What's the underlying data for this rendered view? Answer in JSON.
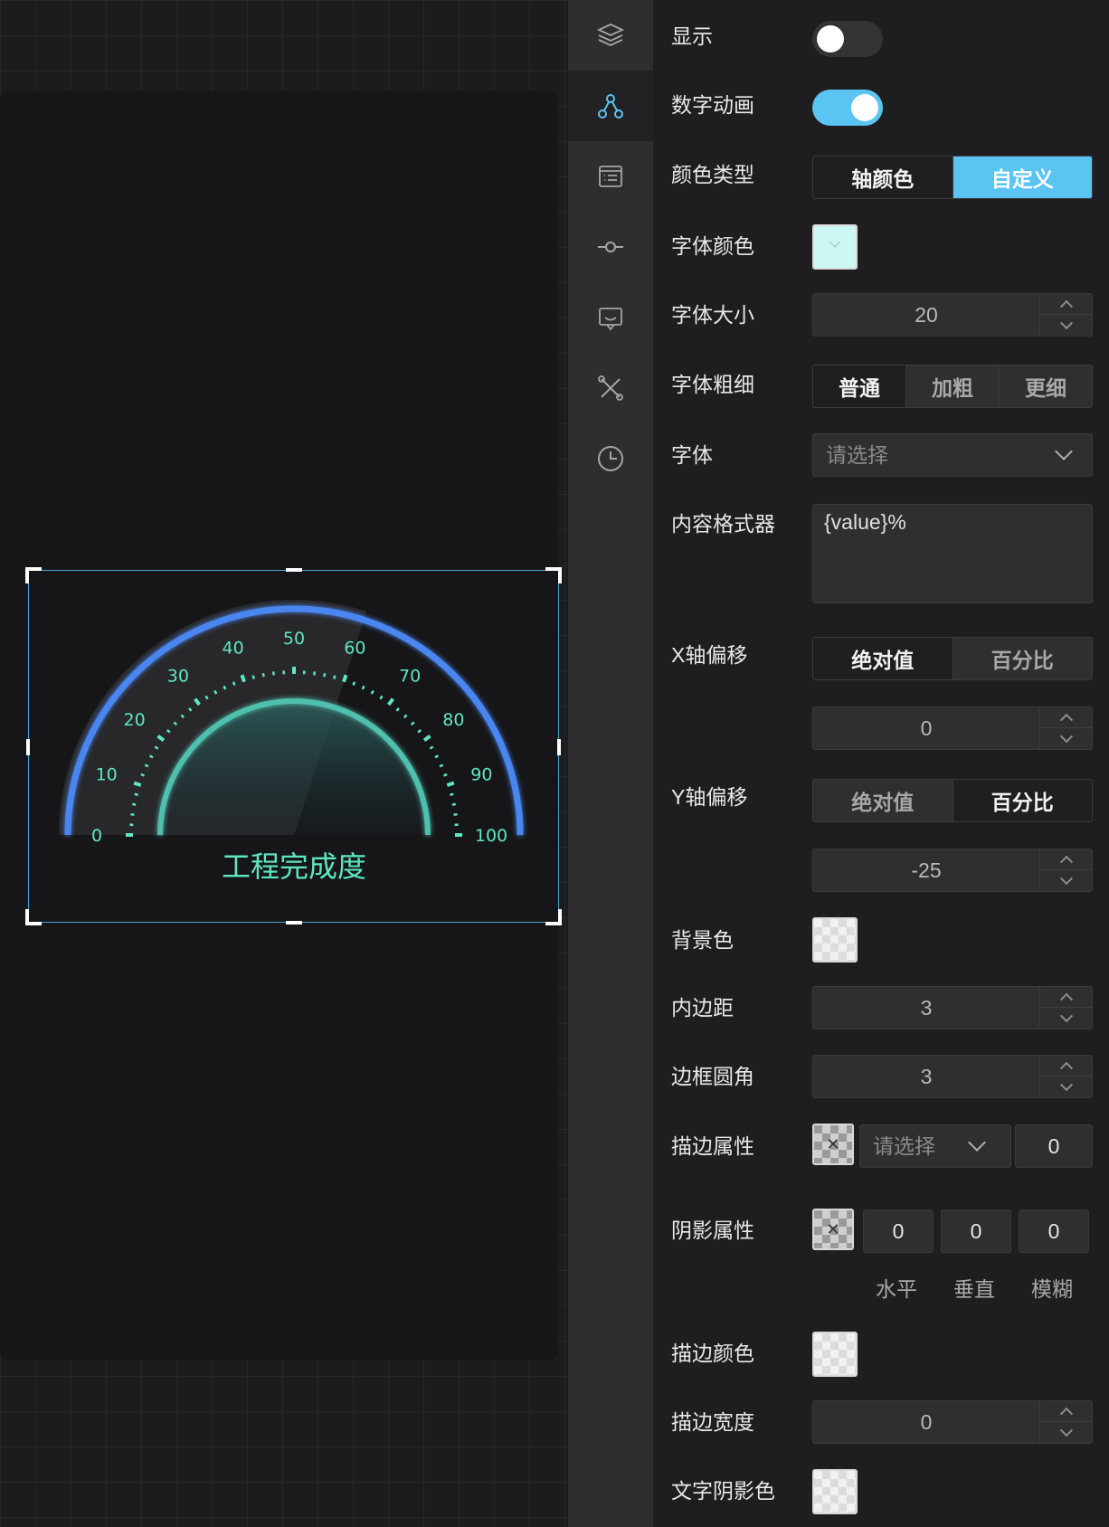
{
  "gauge": {
    "title": "工程完成度",
    "min": 0,
    "max": 100,
    "progress": 60,
    "ticks": [
      "0",
      "10",
      "20",
      "30",
      "40",
      "50",
      "60",
      "70",
      "80",
      "90",
      "100"
    ],
    "colors": {
      "arc": "#4a86f0",
      "accent": "#5ee6c3",
      "inner": "#4fbfae"
    }
  },
  "rail": {
    "icons": [
      "layers-icon",
      "component-nodes-icon",
      "data-list-icon",
      "event-commit-icon",
      "message-icon",
      "tools-icon",
      "clock-icon"
    ],
    "active_index": 1,
    "accent": "#5ac4f3"
  },
  "props": {
    "show": {
      "label": "显示",
      "on": false
    },
    "number_animation": {
      "label": "数字动画",
      "on": true
    },
    "color_type": {
      "label": "颜色类型",
      "options": [
        "轴颜色",
        "自定义"
      ],
      "selected": 1
    },
    "font_color": {
      "label": "字体颜色",
      "value": "#cdf7f2"
    },
    "font_size": {
      "label": "字体大小",
      "value": "20"
    },
    "font_weight": {
      "label": "字体粗细",
      "options": [
        "普通",
        "加粗",
        "更细"
      ],
      "selected": 0
    },
    "font_family": {
      "label": "字体",
      "placeholder": "请选择"
    },
    "formatter": {
      "label": "内容格式器",
      "value": "{value}%"
    },
    "x_offset": {
      "label": "X轴偏移",
      "options": [
        "绝对值",
        "百分比"
      ],
      "selected": 0,
      "value": "0"
    },
    "y_offset": {
      "label": "Y轴偏移",
      "options": [
        "绝对值",
        "百分比"
      ],
      "selected": 1,
      "value": "-25"
    },
    "background": {
      "label": "背景色"
    },
    "padding": {
      "label": "内边距",
      "value": "3"
    },
    "border_radius": {
      "label": "边框圆角",
      "value": "3"
    },
    "stroke": {
      "label": "描边属性",
      "placeholder": "请选择",
      "value": "0"
    },
    "shadow": {
      "label": "阴影属性",
      "values": [
        "0",
        "0",
        "0"
      ],
      "captions": [
        "水平",
        "垂直",
        "模糊"
      ]
    },
    "stroke_color": {
      "label": "描边颜色"
    },
    "stroke_width": {
      "label": "描边宽度",
      "value": "0"
    },
    "text_shadow_color": {
      "label": "文字阴影色"
    }
  }
}
